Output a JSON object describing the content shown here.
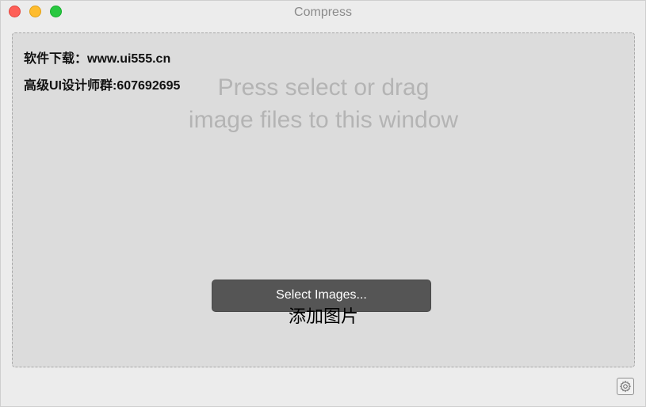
{
  "window": {
    "title": "Compress"
  },
  "dropzone": {
    "watermark_line1": "软件下载：www.ui555.cn",
    "watermark_line2": "高级UI设计师群:607692695",
    "hint_line1": "Press select or drag",
    "hint_line2": "image files to this window",
    "select_button_label": "Select Images...",
    "chinese_label": "添加图片"
  },
  "icons": {
    "settings": "gear-icon"
  },
  "colors": {
    "close": "#fe5f57",
    "minimize": "#febc2e",
    "zoom": "#28c840",
    "button": "#555555"
  }
}
